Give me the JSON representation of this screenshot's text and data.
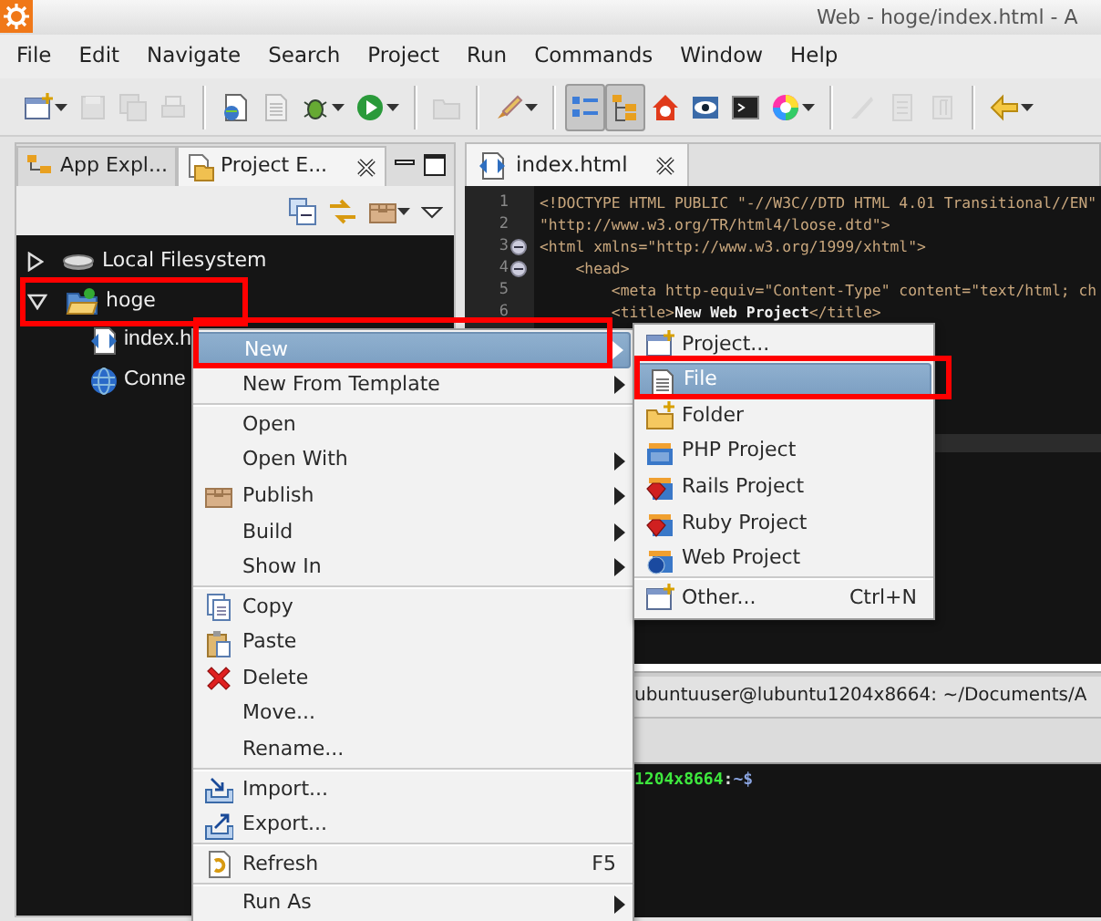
{
  "window": {
    "title": "Web - hoge/index.html - A"
  },
  "menu_bar": [
    "File",
    "Edit",
    "Navigate",
    "Search",
    "Project",
    "Run",
    "Commands",
    "Window",
    "Help"
  ],
  "toolbar": [
    {
      "disabled": false,
      "pressed": false,
      "dropdown": true
    },
    {
      "disabled": true,
      "pressed": false,
      "dropdown": false
    },
    {
      "disabled": true,
      "pressed": false,
      "dropdown": false
    },
    {
      "disabled": true,
      "pressed": false,
      "dropdown": false
    },
    {
      "disabled": false,
      "pressed": false,
      "dropdown": false,
      "group_start": true
    },
    {
      "disabled": true,
      "pressed": false,
      "dropdown": false
    },
    {
      "disabled": false,
      "pressed": false,
      "dropdown": true
    },
    {
      "disabled": false,
      "pressed": false,
      "dropdown": true
    },
    {
      "disabled": true,
      "pressed": false,
      "dropdown": false,
      "group_start": true
    },
    {
      "disabled": false,
      "pressed": false,
      "dropdown": true,
      "group_start": true
    },
    {
      "disabled": false,
      "pressed": true,
      "dropdown": false,
      "group_start": true
    },
    {
      "disabled": false,
      "pressed": true,
      "dropdown": false
    },
    {
      "disabled": false,
      "pressed": false,
      "dropdown": false
    },
    {
      "disabled": false,
      "pressed": false,
      "dropdown": false
    },
    {
      "disabled": false,
      "pressed": false,
      "dropdown": false
    },
    {
      "disabled": false,
      "pressed": false,
      "dropdown": true
    },
    {
      "disabled": true,
      "pressed": false,
      "dropdown": false,
      "group_start": true
    },
    {
      "disabled": true,
      "pressed": false,
      "dropdown": false
    },
    {
      "disabled": true,
      "pressed": false,
      "dropdown": false
    },
    {
      "disabled": false,
      "pressed": false,
      "dropdown": true,
      "group_start": true
    }
  ],
  "left_panel": {
    "tabs": [
      {
        "label": "App Expl...",
        "selected": false
      },
      {
        "label": "Project E...",
        "selected": true
      }
    ],
    "tree": [
      {
        "label": "Local Filesystem",
        "expanded": false
      },
      {
        "label": "hoge",
        "expanded": true,
        "annotated": true,
        "children": [
          {
            "label": "index.h"
          },
          {
            "label": "Conne"
          }
        ]
      }
    ]
  },
  "editor": {
    "tab": {
      "label": "index.html"
    },
    "lines": [
      {
        "number": "1",
        "foldable": false,
        "segments": [
          {
            "kind": "tag",
            "text": "<!DOCTYPE HTML PUBLIC \"-//W3C//DTD HTML 4.01 Transitional//EN\""
          }
        ]
      },
      {
        "number": "2",
        "foldable": false,
        "segments": [
          {
            "kind": "tag",
            "text": "\"http://www.w3.org/TR/html4/loose.dtd\">"
          }
        ]
      },
      {
        "number": "3",
        "foldable": true,
        "segments": [
          {
            "kind": "tag",
            "text": "<html xmlns=\"http://www.w3.org/1999/xhtml\">"
          }
        ]
      },
      {
        "number": "4",
        "foldable": true,
        "segments": [
          {
            "kind": "tag",
            "text": "    <head>"
          }
        ]
      },
      {
        "number": "5",
        "foldable": false,
        "segments": [
          {
            "kind": "tag",
            "text": "        <meta http-equiv=\"Content-Type\" content=\"text/html; ch"
          }
        ]
      },
      {
        "number": "6",
        "foldable": false,
        "segments": [
          {
            "kind": "tag",
            "text": "        <title>"
          },
          {
            "kind": "text",
            "text": "New Web Project"
          },
          {
            "kind": "tag",
            "text": "</title>"
          }
        ]
      }
    ]
  },
  "terminal": {
    "title": "ubuntuuser@lubuntu1204x8664: ~/Documents/A",
    "prompt": [
      {
        "kind": "host",
        "text": "1204x8664"
      },
      {
        "kind": "plain",
        "text": ":"
      },
      {
        "kind": "path",
        "text": "~$"
      }
    ]
  },
  "context_menu": {
    "items": [
      {
        "kind": "item",
        "label": "New",
        "submenu": true,
        "selected": true,
        "annotated": true
      },
      {
        "kind": "item",
        "label": "New From Template",
        "submenu": true,
        "selected": false
      },
      {
        "kind": "separator"
      },
      {
        "kind": "item",
        "label": "Open",
        "submenu": false,
        "selected": false
      },
      {
        "kind": "item",
        "label": "Open With",
        "submenu": true,
        "selected": false
      },
      {
        "kind": "item",
        "label": "Publish",
        "submenu": true,
        "selected": false
      },
      {
        "kind": "item",
        "label": "Build",
        "submenu": true,
        "selected": false
      },
      {
        "kind": "item",
        "label": "Show In",
        "submenu": true,
        "selected": false
      },
      {
        "kind": "separator"
      },
      {
        "kind": "item",
        "label": "Copy",
        "submenu": false,
        "selected": false
      },
      {
        "kind": "item",
        "label": "Paste",
        "submenu": false,
        "selected": false
      },
      {
        "kind": "item",
        "label": "Delete",
        "submenu": false,
        "selected": false
      },
      {
        "kind": "item",
        "label": "Move...",
        "submenu": false,
        "selected": false
      },
      {
        "kind": "item",
        "label": "Rename...",
        "submenu": false,
        "selected": false
      },
      {
        "kind": "separator"
      },
      {
        "kind": "item",
        "label": "Import...",
        "submenu": false,
        "selected": false
      },
      {
        "kind": "item",
        "label": "Export...",
        "submenu": false,
        "selected": false
      },
      {
        "kind": "separator"
      },
      {
        "kind": "item",
        "label": "Refresh",
        "shortcut": "F5",
        "submenu": false,
        "selected": false
      },
      {
        "kind": "separator"
      },
      {
        "kind": "item",
        "label": "Run As",
        "submenu": true,
        "selected": false
      }
    ]
  },
  "submenu": {
    "items": [
      {
        "kind": "item",
        "label": "Project...",
        "selected": false
      },
      {
        "kind": "item",
        "label": "File",
        "selected": true,
        "annotated": true
      },
      {
        "kind": "item",
        "label": "Folder",
        "selected": false
      },
      {
        "kind": "item",
        "label": "PHP Project",
        "selected": false
      },
      {
        "kind": "item",
        "label": "Rails Project",
        "selected": false
      },
      {
        "kind": "item",
        "label": "Ruby Project",
        "selected": false
      },
      {
        "kind": "item",
        "label": "Web Project",
        "selected": false
      },
      {
        "kind": "separator"
      },
      {
        "kind": "item",
        "label": "Other...",
        "shortcut": "Ctrl+N",
        "selected": false
      }
    ]
  }
}
